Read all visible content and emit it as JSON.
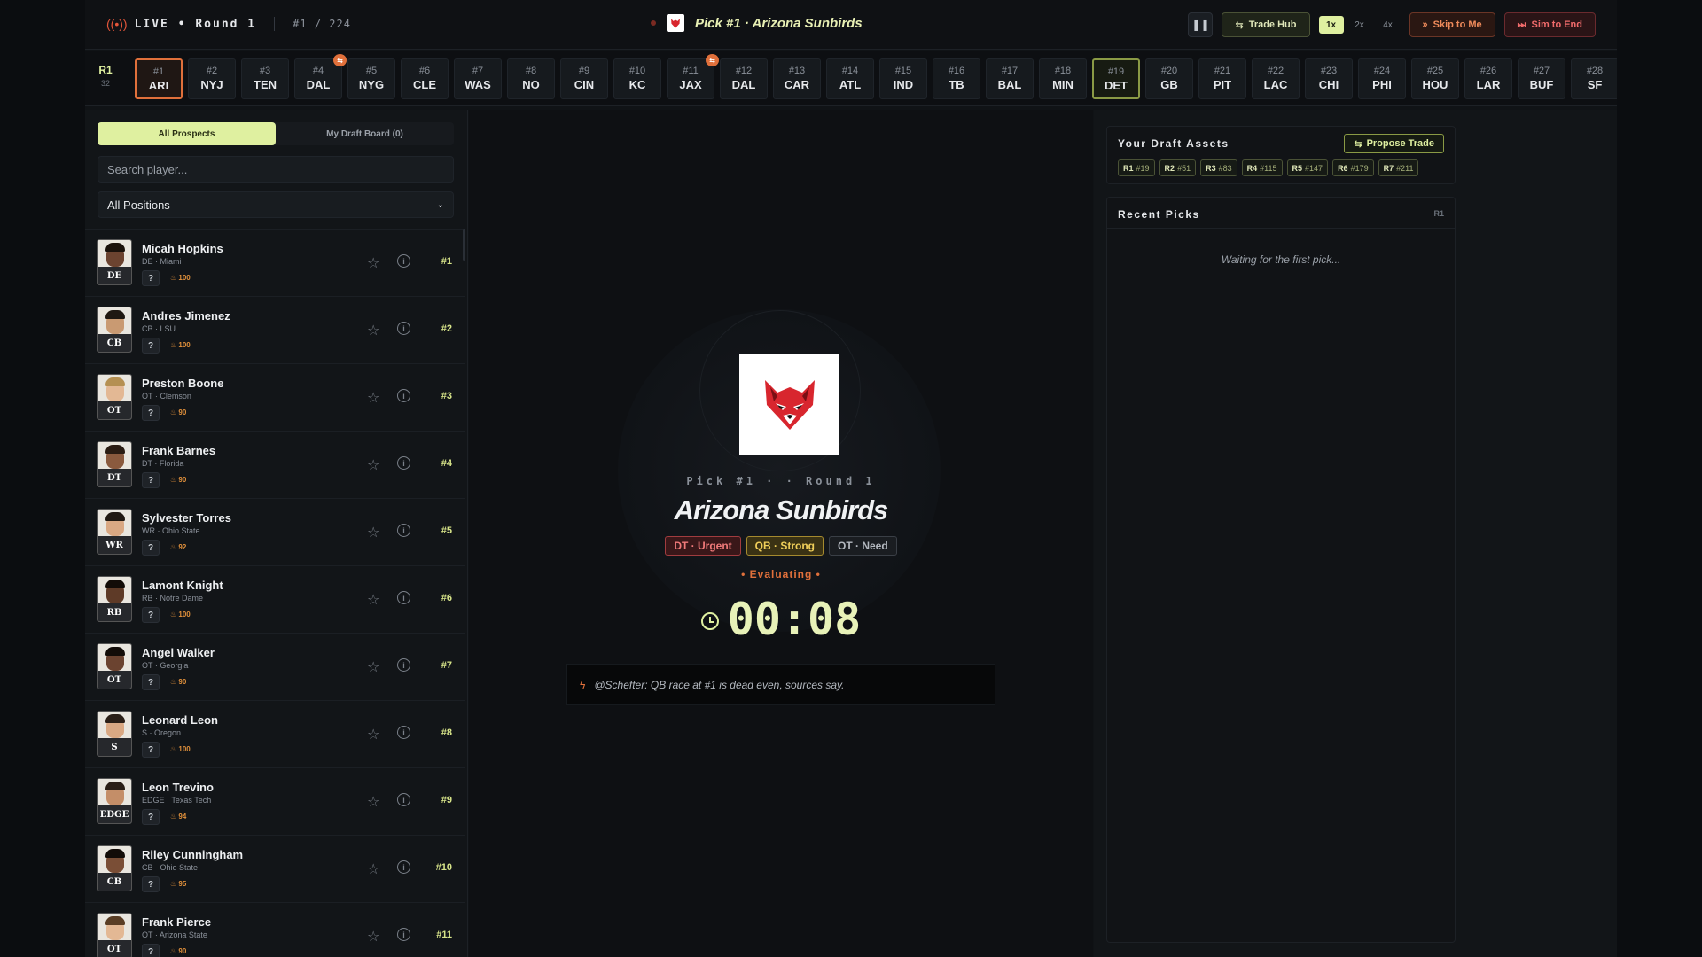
{
  "header": {
    "live_label": "LIVE • Round 1",
    "pick_count": "#1 / 224",
    "current_pick_title": "Pick #1 · Arizona Sunbirds",
    "trade_hub": "Trade Hub",
    "speeds": [
      "1x",
      "2x",
      "4x"
    ],
    "active_speed": "1x",
    "skip_to_me": "Skip to Me",
    "sim_to_end": "Sim to End"
  },
  "ticker": {
    "round": "R1",
    "round_count": "32",
    "picks": [
      {
        "num": "#1",
        "team": "ARI",
        "state": "current"
      },
      {
        "num": "#2",
        "team": "NYJ"
      },
      {
        "num": "#3",
        "team": "TEN"
      },
      {
        "num": "#4",
        "team": "DAL",
        "badge": "⇆"
      },
      {
        "num": "#5",
        "team": "NYG"
      },
      {
        "num": "#6",
        "team": "CLE"
      },
      {
        "num": "#7",
        "team": "WAS"
      },
      {
        "num": "#8",
        "team": "NO"
      },
      {
        "num": "#9",
        "team": "CIN"
      },
      {
        "num": "#10",
        "team": "KC"
      },
      {
        "num": "#11",
        "team": "JAX",
        "badge": "⇆"
      },
      {
        "num": "#12",
        "team": "DAL"
      },
      {
        "num": "#13",
        "team": "CAR"
      },
      {
        "num": "#14",
        "team": "ATL"
      },
      {
        "num": "#15",
        "team": "IND"
      },
      {
        "num": "#16",
        "team": "TB"
      },
      {
        "num": "#17",
        "team": "BAL"
      },
      {
        "num": "#18",
        "team": "MIN"
      },
      {
        "num": "#19",
        "team": "DET",
        "state": "mine"
      },
      {
        "num": "#20",
        "team": "GB"
      },
      {
        "num": "#21",
        "team": "PIT"
      },
      {
        "num": "#22",
        "team": "LAC"
      },
      {
        "num": "#23",
        "team": "CHI"
      },
      {
        "num": "#24",
        "team": "PHI"
      },
      {
        "num": "#25",
        "team": "HOU"
      },
      {
        "num": "#26",
        "team": "LAR"
      },
      {
        "num": "#27",
        "team": "BUF"
      },
      {
        "num": "#28",
        "team": "SF"
      }
    ]
  },
  "prospects": {
    "tab_all": "All Prospects",
    "tab_board": "My Draft Board (0)",
    "search_placeholder": "Search player...",
    "position_filter": "All Positions",
    "players": [
      {
        "name": "Micah Hopkins",
        "sub": "DE · Miami",
        "pos": "DE",
        "grade": "100",
        "rank": "#1",
        "skin": "#6b4330",
        "hair": "#1a120c"
      },
      {
        "name": "Andres Jimenez",
        "sub": "CB · LSU",
        "pos": "CB",
        "grade": "100",
        "rank": "#2",
        "skin": "#c99a72",
        "hair": "#1f1812"
      },
      {
        "name": "Preston Boone",
        "sub": "OT · Clemson",
        "pos": "OT",
        "grade": "90",
        "rank": "#3",
        "skin": "#e3b894",
        "hair": "#b59052"
      },
      {
        "name": "Frank Barnes",
        "sub": "DT · Florida",
        "pos": "DT",
        "grade": "90",
        "rank": "#4",
        "skin": "#8a5a3e",
        "hair": "#2a1c13"
      },
      {
        "name": "Sylvester Torres",
        "sub": "WR · Ohio State",
        "pos": "WR",
        "grade": "92",
        "rank": "#5",
        "skin": "#d9a883",
        "hair": "#1f1812"
      },
      {
        "name": "Lamont Knight",
        "sub": "RB · Notre Dame",
        "pos": "RB",
        "grade": "100",
        "rank": "#6",
        "skin": "#5e3a27",
        "hair": "#120c08"
      },
      {
        "name": "Angel Walker",
        "sub": "OT · Georgia",
        "pos": "OT",
        "grade": "90",
        "rank": "#7",
        "skin": "#6b4330",
        "hair": "#120c08"
      },
      {
        "name": "Leonard Leon",
        "sub": "S · Oregon",
        "pos": "S",
        "grade": "100",
        "rank": "#8",
        "skin": "#d9a883",
        "hair": "#2a1f17"
      },
      {
        "name": "Leon Trevino",
        "sub": "EDGE · Texas Tech",
        "pos": "EDGE",
        "grade": "94",
        "rank": "#9",
        "skin": "#c48e68",
        "hair": "#2a1f17"
      },
      {
        "name": "Riley Cunningham",
        "sub": "CB · Ohio State",
        "pos": "CB",
        "grade": "95",
        "rank": "#10",
        "skin": "#7a4e36",
        "hair": "#120c08"
      },
      {
        "name": "Frank Pierce",
        "sub": "OT · Arizona State",
        "pos": "OT",
        "grade": "90",
        "rank": "#11",
        "skin": "#e3b894",
        "hair": "#5a3e25"
      }
    ]
  },
  "on_clock": {
    "pick_label": "Pick #1 · · Round 1",
    "team_name": "Arizona Sunbirds",
    "needs": [
      {
        "label": "DT · Urgent",
        "level": "urgent"
      },
      {
        "label": "QB · Strong",
        "level": "strong"
      },
      {
        "label": "OT · Need",
        "level": "normal"
      }
    ],
    "status": "• Evaluating •",
    "timer": "00:08",
    "news": "@Schefter: QB race at #1 is dead even, sources say."
  },
  "assets": {
    "title": "Your Draft Assets",
    "propose_trade": "Propose Trade",
    "picks": [
      {
        "round": "R1",
        "pick": "#19"
      },
      {
        "round": "R2",
        "pick": "#51"
      },
      {
        "round": "R3",
        "pick": "#83"
      },
      {
        "round": "R4",
        "pick": "#115"
      },
      {
        "round": "R5",
        "pick": "#147"
      },
      {
        "round": "R6",
        "pick": "#179"
      },
      {
        "round": "R7",
        "pick": "#211"
      }
    ]
  },
  "recent": {
    "title": "Recent Picks",
    "round_tag": "R1",
    "empty": "Waiting for the first pick..."
  },
  "colors": {
    "accent": "#dff0a0",
    "orange": "#e0703b",
    "red": "#f06b6b",
    "team_red": "#d8262e"
  }
}
